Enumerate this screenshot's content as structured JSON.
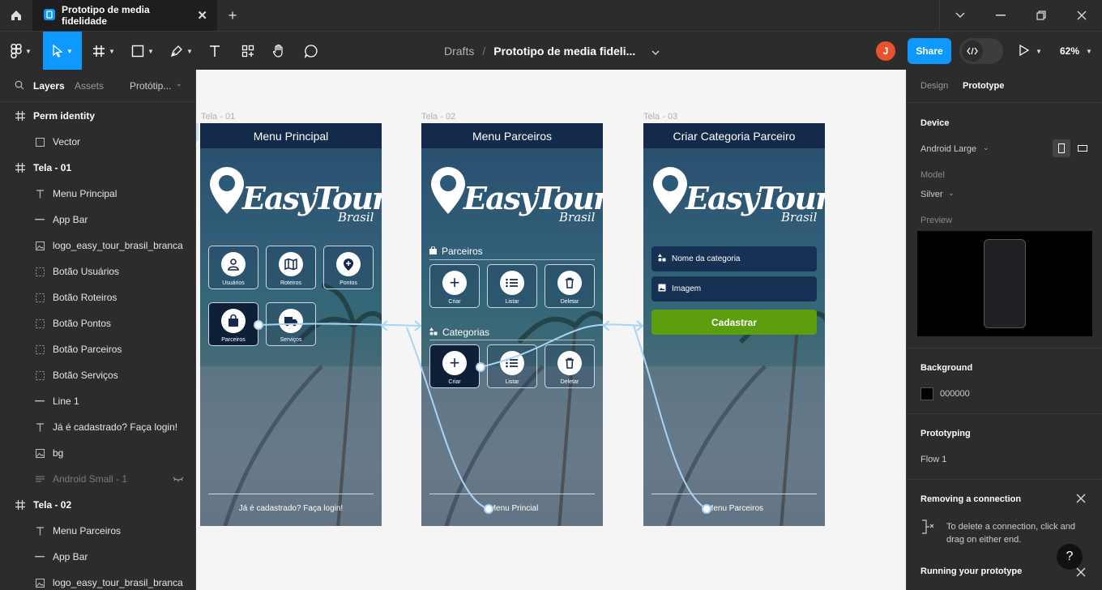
{
  "tabbar": {
    "file_tab_title": "Prototipo de media fidelidade",
    "close_glyph": "✕",
    "new_tab_glyph": "+"
  },
  "toolbar": {
    "breadcrumb_root": "Drafts",
    "breadcrumb_sep": "/",
    "file_name": "Prototipo de media fideli...",
    "avatar_initial": "J",
    "share_label": "Share",
    "zoom_label": "62%"
  },
  "left_panel": {
    "tab_layers": "Layers",
    "tab_assets": "Assets",
    "tab_page": "Protótip...",
    "layers": [
      {
        "label": "Perm identity",
        "kind": "frame"
      },
      {
        "label": "Vector",
        "kind": "vector"
      },
      {
        "label": "Tela - 01",
        "kind": "frame"
      },
      {
        "label": "Menu Principal",
        "kind": "text"
      },
      {
        "label": "App Bar",
        "kind": "line"
      },
      {
        "label": "logo_easy_tour_brasil_branca",
        "kind": "image"
      },
      {
        "label": "Botão Usuários",
        "kind": "dashed"
      },
      {
        "label": "Botão Roteiros",
        "kind": "dashed"
      },
      {
        "label": "Botão Pontos",
        "kind": "dashed"
      },
      {
        "label": "Botão Parceiros",
        "kind": "dashed"
      },
      {
        "label": "Botão Serviços",
        "kind": "dashed"
      },
      {
        "label": "Line 1",
        "kind": "line"
      },
      {
        "label": "Já é cadastrado? Faça login!",
        "kind": "text"
      },
      {
        "label": "bg",
        "kind": "image"
      },
      {
        "label": "Android Small - 1",
        "kind": "hidden"
      },
      {
        "label": "Tela - 02",
        "kind": "frame"
      },
      {
        "label": "Menu Parceiros",
        "kind": "text"
      },
      {
        "label": "App Bar",
        "kind": "line"
      },
      {
        "label": "logo_easy_tour_brasil_branca",
        "kind": "image"
      }
    ]
  },
  "canvas": {
    "logo_main": "EasyTour",
    "logo_sub": "Brasil",
    "screen1": {
      "frame_label": "Tela - 01",
      "title": "Menu Principal",
      "tiles": [
        "Usuários",
        "Roteiros",
        "Pontos",
        "Parceiros",
        "Serviços"
      ],
      "footer": "Já é cadastrado? Faça login!"
    },
    "screen2": {
      "frame_label": "Tela - 02",
      "title": "Menu Parceiros",
      "section_partners": "Parceiros",
      "section_categories": "Categorias",
      "tiles": [
        "Criar",
        "Listar",
        "Deletar"
      ],
      "footer": "Menu Princial"
    },
    "screen3": {
      "frame_label": "Tela - 03",
      "title": "Criar Categoria Parceiro",
      "field_name": "Nome da categoria",
      "field_image": "Imagem",
      "submit": "Cadastrar",
      "footer": "Menu Parceiros"
    }
  },
  "right_panel": {
    "tab_design": "Design",
    "tab_prototype": "Prototype",
    "device_title": "Device",
    "device_value": "Android Large",
    "model_label": "Model",
    "model_value": "Silver",
    "preview_label": "Preview",
    "background_title": "Background",
    "background_hex": "000000",
    "prototyping_title": "Prototyping",
    "flow_name": "Flow 1",
    "remove_title": "Removing a connection",
    "remove_text": "To delete a connection, click and drag on either end.",
    "running_title": "Running your prototype",
    "help_glyph": "?"
  },
  "colors": {
    "accent": "#0d99ff",
    "appbar": "#142a4a",
    "button_green": "#5c9e0e",
    "connector": "#a8d4f5",
    "avatar": "#e8522c"
  }
}
